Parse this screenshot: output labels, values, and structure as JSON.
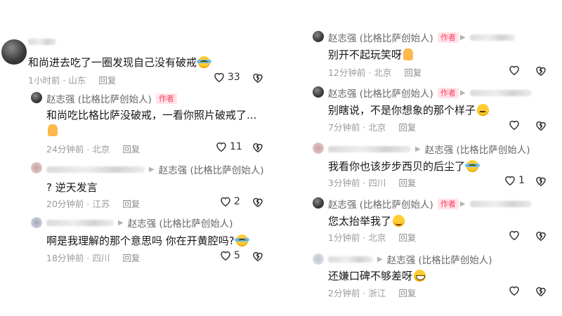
{
  "left": [
    {
      "author": "",
      "badge": "",
      "reply_to": "",
      "text": "和尚进去吃了一圈发现自己没有破戒",
      "text2": "",
      "emoji": "cry",
      "time": "1小时前 · 山东",
      "reply": "回复",
      "likes": "33",
      "avatar_icon": "user-avatar-icon"
    },
    {
      "author": "赵志强 (比格比萨创始人)",
      "badge": "作者",
      "reply_to": "",
      "text": "和尚吃比格比萨没破戒，一看你照片破戒了...",
      "text2": "",
      "emoji": "pray",
      "time": "24分钟前 · 北京",
      "reply": "回复",
      "likes": "11"
    },
    {
      "author": "",
      "badge": "",
      "reply_to": "赵志强 (比格比萨创始人)",
      "text": "? 逆天发言",
      "text2": "",
      "emoji": "",
      "time": "20分钟前 · 江苏",
      "reply": "回复",
      "likes": "2"
    },
    {
      "author": "",
      "badge": "",
      "reply_to": "赵志强 (比格比萨创始人)",
      "text": "啊是我理解的那个意思吗 你在开黄腔吗?",
      "text2": "",
      "emoji": "cry",
      "time": "18分钟前 · 四川",
      "reply": "回复",
      "likes": "5"
    }
  ],
  "right": [
    {
      "author": "赵志强 (比格比萨创始人)",
      "badge": "作者",
      "reply_to": "",
      "text": "别开不起玩笑呀",
      "emoji": "pray",
      "time": "12分钟前 · 北京",
      "reply": "回复",
      "likes": ""
    },
    {
      "author": "赵志强 (比格比萨创始人)",
      "badge": "作者",
      "reply_to": "",
      "text": "别瞎说，不是你想象的那个样子",
      "emoji": "think",
      "time": "7分钟前 · 北京",
      "reply": "回复",
      "likes": ""
    },
    {
      "author": "",
      "badge": "",
      "reply_to": "赵志强 (比格比萨创始人)",
      "text": "我看你也该步步西贝的后尘了",
      "emoji": "cry",
      "time": "3分钟前 · 四川",
      "reply": "回复",
      "likes": "1"
    },
    {
      "author": "赵志强 (比格比萨创始人)",
      "badge": "作者",
      "reply_to": "",
      "text": "您太抬举我了",
      "emoji": "smirk",
      "time": "1分钟前 · 北京",
      "reply": "回复",
      "likes": ""
    },
    {
      "author": "",
      "badge": "",
      "reply_to": "赵志强 (比格比萨创始人)",
      "text": "还嫌口碑不够差呀",
      "emoji": "grin",
      "time": "2分钟前 · 浙江",
      "reply": "回复",
      "likes": ""
    }
  ]
}
